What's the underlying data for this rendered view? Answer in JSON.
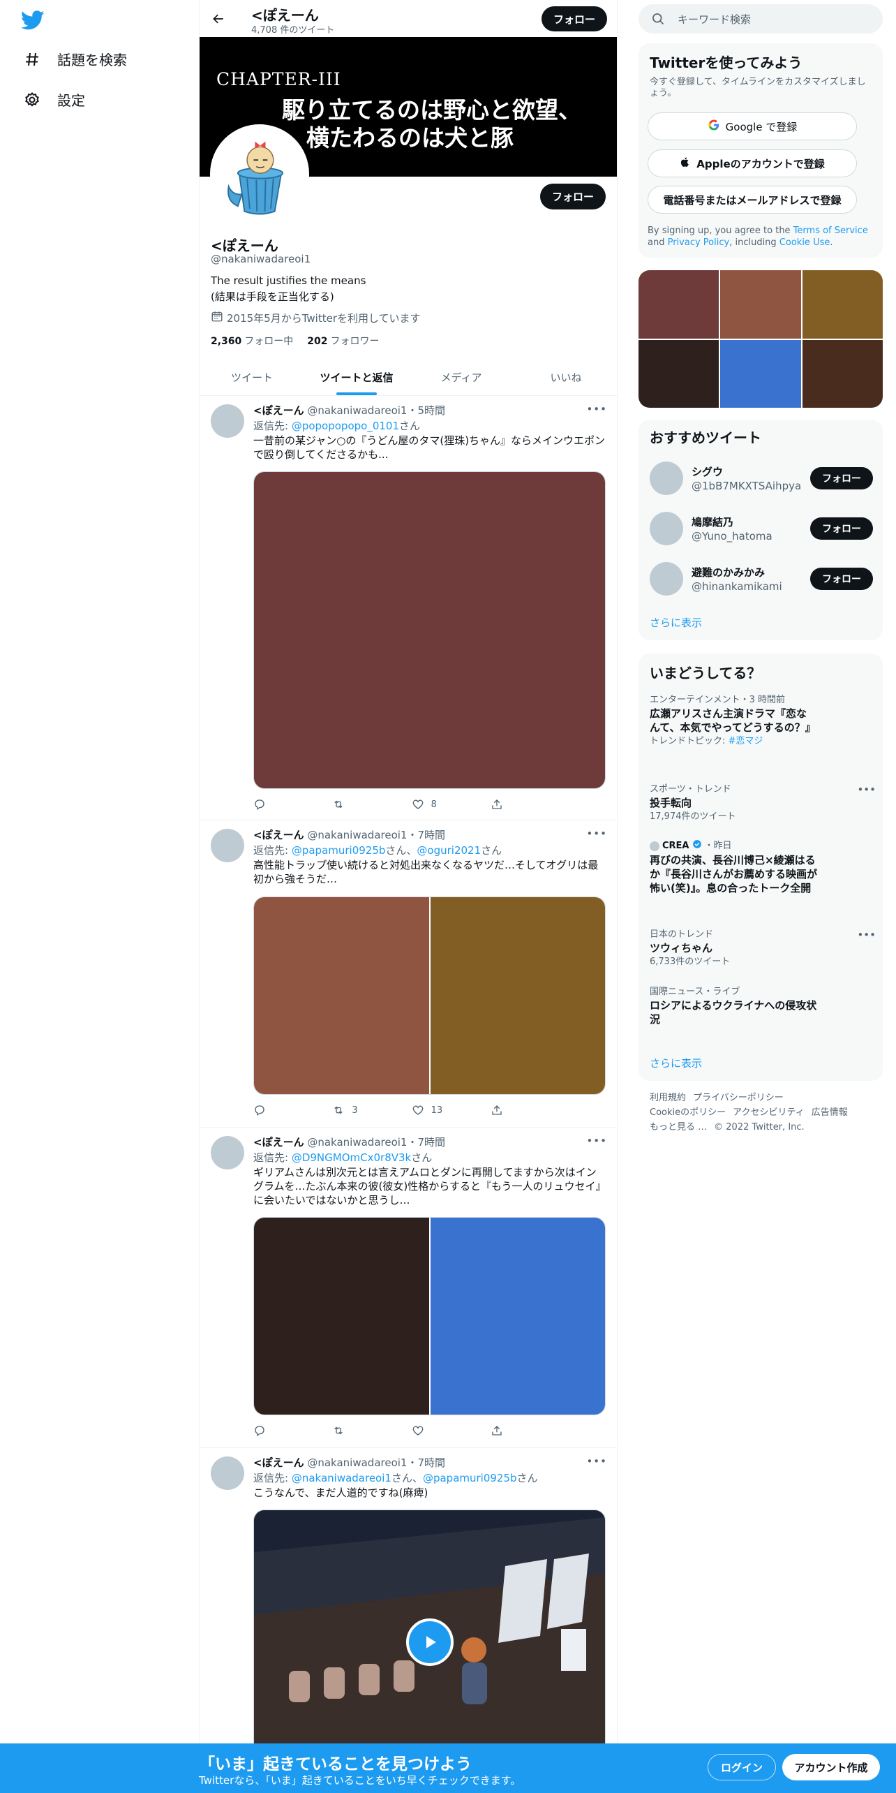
{
  "nav": {
    "items": [
      {
        "label": "話題を検索",
        "icon": "hashtag-icon"
      },
      {
        "label": "設定",
        "icon": "gear-icon"
      }
    ]
  },
  "header": {
    "name": "<ぽえーん",
    "tweet_count": "4,708 件のツイート",
    "follow_label": "フォロー"
  },
  "banner": {
    "chapter": "CHAPTER-III",
    "line1": "駆り立てるのは野心と欲望、",
    "line2": "横たわるのは犬と豚"
  },
  "profile": {
    "name": "<ぽえーん",
    "handle": "@nakaniwadareoi1",
    "bio_line1": "The result justifies the means",
    "bio_line2": "(結果は手段を正当化する)",
    "joined": "2015年5月からTwitterを利用しています",
    "following_count": "2,360",
    "following_label": "フォロー中",
    "followers_count": "202",
    "followers_label": "フォロワー",
    "follow_label": "フォロー"
  },
  "tabs": [
    {
      "label": "ツイート"
    },
    {
      "label": "ツイートと返信"
    },
    {
      "label": "メディア"
    },
    {
      "label": "いいね"
    }
  ],
  "tweets": [
    {
      "name": "<ぽえーん",
      "meta": "@nakaniwadareoi1・5時間",
      "reply_prefix": "返信先: ",
      "reply_to_1": "@popopopopo_0101",
      "reply_mid": "",
      "reply_to_2": "",
      "reply_suffix": "さん",
      "text": "一昔前の某ジャン○の『うどん屋のタマ(狸珠)ちゃん』ならメインウエポンで殴り倒してくださるかも...",
      "likes": "8",
      "retweets": "",
      "media_colors": [
        "#6e3a3a"
      ]
    },
    {
      "name": "<ぽえーん",
      "meta": "@nakaniwadareoi1・7時間",
      "reply_prefix": "返信先: ",
      "reply_to_1": "@papamuri0925b",
      "reply_mid": "さん、",
      "reply_to_2": "@oguri2021",
      "reply_suffix": "さん",
      "text": "高性能トラップ使い続けると対処出来なくなるヤツだ…そしてオグリは最初から強そうだ…",
      "likes": "13",
      "retweets": "3",
      "media_colors": [
        "#8f5540",
        "#835e24"
      ]
    },
    {
      "name": "<ぽえーん",
      "meta": "@nakaniwadareoi1・7時間",
      "reply_prefix": "返信先: ",
      "reply_to_1": "@D9NGMOmCx0r8V3k",
      "reply_mid": "",
      "reply_to_2": "",
      "reply_suffix": "さん",
      "text": "ギリアムさんは別次元とは言えアムロとダンに再開してますから次はイングラムを…たぶん本来の彼(彼女)性格からすると『もう一人のリュウセイ』に会いたいではないかと思うし…",
      "likes": "",
      "retweets": "",
      "media_colors": [
        "#2e201d",
        "#3a72d0"
      ]
    },
    {
      "name": "<ぽえーん",
      "meta": "@nakaniwadareoi1・7時間",
      "reply_prefix": "返信先: ",
      "reply_to_1": "@nakaniwadareoi1",
      "reply_mid": "さん、",
      "reply_to_2": "@papamuri0925b",
      "reply_suffix": "さん",
      "text": "こうなんで、まだ人道的ですね(麻痺)",
      "likes": "",
      "retweets": "",
      "media_colors": [
        "#1b2233"
      ]
    }
  ],
  "search": {
    "placeholder": "キーワード検索"
  },
  "signup": {
    "title": "Twitterを使ってみよう",
    "subtitle": "今すぐ登録して、タイムラインをカスタマイズしましょう。",
    "google": "Google で登録",
    "apple": "Appleのアカウントで登録",
    "phone": "電話番号またはメールアドレスで登録",
    "terms_prefix": "By signing up, you agree to the ",
    "terms_link": "Terms of Service",
    "terms_and": " and ",
    "privacy_link": "Privacy Policy",
    "terms_including": ", including ",
    "cookie_link": "Cookie Use",
    "terms_end": "."
  },
  "media_grid": {
    "colors": [
      "#6e3a3a",
      "#8f5540",
      "#835e24",
      "#2e201d",
      "#3a72d0",
      "#4a2c1e"
    ]
  },
  "recommend": {
    "title": "おすすめツイート",
    "users": [
      {
        "name": "シグウ",
        "handle": "@1bB7MKXTSAihpya",
        "follow": "フォロー"
      },
      {
        "name": "鳩摩結乃",
        "handle": "@Yuno_hatoma",
        "follow": "フォロー"
      },
      {
        "name": "避難のかみかみ",
        "handle": "@hinankamikami",
        "follow": "フォロー"
      }
    ],
    "more": "さらに表示"
  },
  "trends": {
    "title": "いまどうしてる？",
    "items": [
      {
        "context": "エンターテインメント・3 時間前",
        "title": "広瀬アリスさん主演ドラマ『恋なんて、本気でやってどうするの？』",
        "meta_prefix": "トレンドトピック: ",
        "meta_link": "#恋マジ"
      },
      {
        "context": "スポーツ・トレンド",
        "title": "投手転向",
        "meta": "17,974件のツイート"
      },
      {
        "context_source": "CREA",
        "context_time": "・昨日",
        "title": "再びの共演、長谷川博己×綾瀬はるか『長谷川さんがお薦めする映画が 怖い(笑)』。息の合ったトーク全開"
      },
      {
        "context": "日本のトレンド",
        "title": "ツウィちゃん",
        "meta": "6,733件のツイート"
      },
      {
        "context": "国際ニュース・ライブ",
        "title": "ロシアによるウクライナへの侵攻状況"
      }
    ],
    "more": "さらに表示"
  },
  "footer": {
    "links": [
      "利用規約",
      "プライバシーポリシー",
      "Cookieのポリシー",
      "アクセシビリティ",
      "広告情報",
      "もっと見る …",
      "© 2022 Twitter, Inc."
    ]
  },
  "bottom_bar": {
    "headline": "「いま」起きていることを見つけよう",
    "sub": "Twitterなら、「いま」起きていることをいち早くチェックできます。",
    "login": "ログイン",
    "signup": "アカウント作成"
  },
  "colors": {
    "accent": "#1d9bf0",
    "text": "#0f1419",
    "muted": "#536471"
  }
}
